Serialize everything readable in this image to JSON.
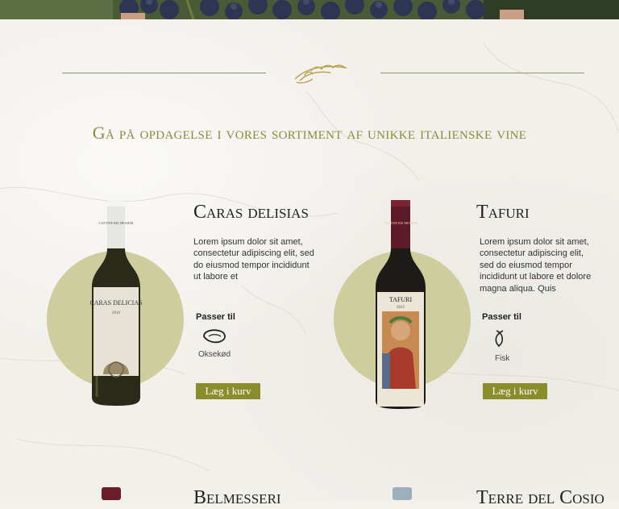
{
  "headline": "Gå på opdagelse i vores sortiment af unikke italienske vine",
  "pairs_label": "Passer til",
  "cart_label": "Læg i kurv",
  "products": [
    {
      "name": "Caras delisias",
      "description": "Lorem ipsum dolor sit amet, consectetur adipiscing elit, sed do eiusmod tempor incididunt ut labore et",
      "pairs_with": "Oksekød",
      "pair_icon": "steak-icon",
      "bottle_label": "CARAS DELICIAS",
      "bottle_year": "2016",
      "capsule": "CANTINE BELMESSERI"
    },
    {
      "name": "Tafuri",
      "description": "Lorem ipsum dolor sit amet, consectetur adipiscing elit, sed do eiusmod tempor incididunt ut labore et dolore magna aliqua. Quis",
      "pairs_with": "Fisk",
      "pair_icon": "fish-icon",
      "bottle_label": "TAFURI",
      "bottle_year": "2015",
      "capsule": "CANTINE BELMESSERI"
    },
    {
      "name": "Belmesseri"
    },
    {
      "name": "Terre del Cosio"
    }
  ],
  "colors": {
    "accent": "#8b8d2c",
    "headline": "#8c8a3c",
    "circle": "#cdcd9e",
    "divider": "#8d9466"
  }
}
